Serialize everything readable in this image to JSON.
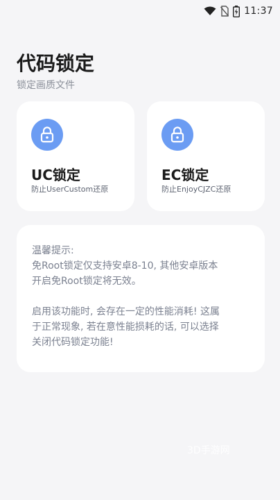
{
  "status_bar": {
    "time": "11:37",
    "icons": [
      "wifi-icon",
      "no-sim-icon",
      "battery-charging-icon"
    ]
  },
  "header": {
    "title": "代码锁定",
    "subtitle": "锁定画质文件"
  },
  "cards": [
    {
      "icon": "lock-icon",
      "title": "UC锁定",
      "description": "防止UserCustom还原"
    },
    {
      "icon": "lock-icon",
      "title": "EC锁定",
      "description": "防止EnjoyCJZC还原"
    }
  ],
  "notice": {
    "lines": [
      "温馨提示:",
      "免Root锁定仅支持安卓8-10, 其他安卓版本",
      "开启免Root锁定将无效。",
      "启用该功能时, 会存在一定的性能消耗! 这属",
      "于正常现象, 若在意性能损耗的话, 可以选择",
      "关闭代码锁定功能!"
    ]
  },
  "watermark": "3D手游网",
  "colors": {
    "background": "#f5f5f7",
    "card": "#ffffff",
    "accent": "#6b9cf3",
    "muted_text": "#7b8190"
  }
}
